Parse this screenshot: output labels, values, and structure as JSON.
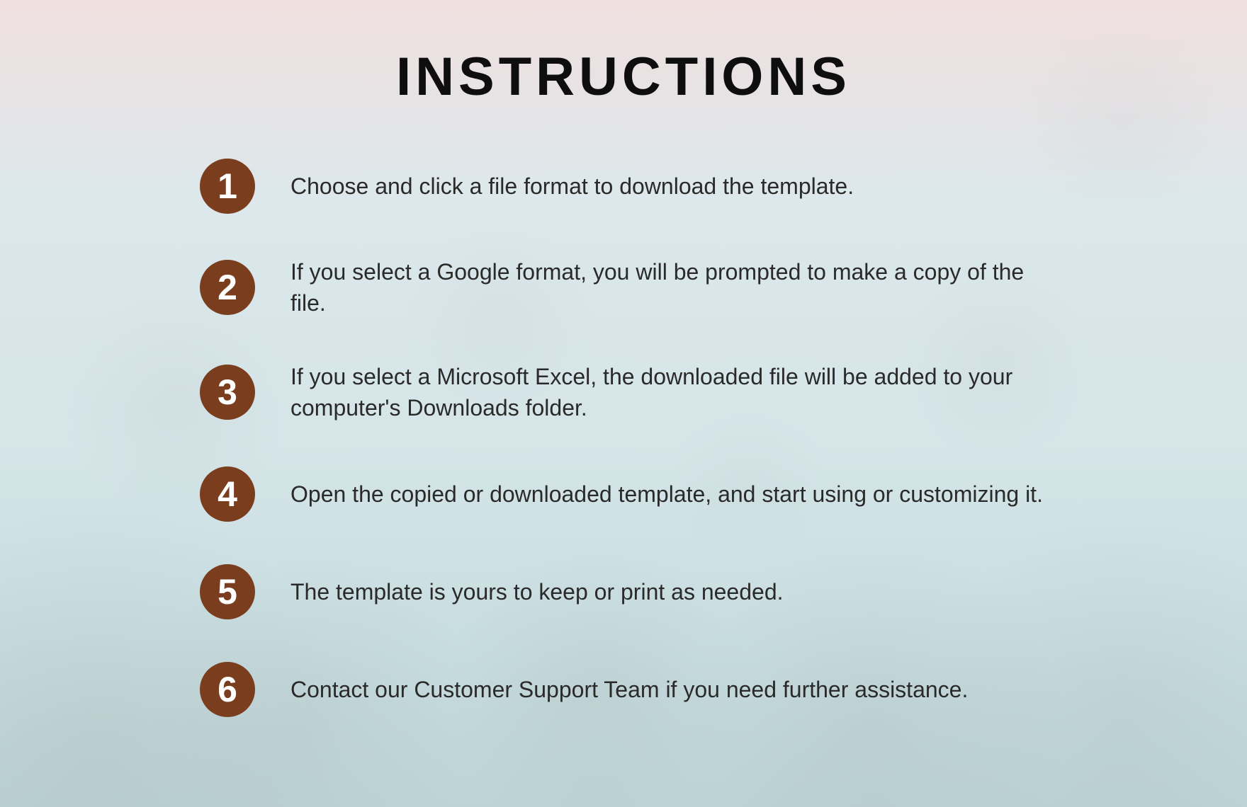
{
  "page": {
    "title": "INSTRUCTIONS"
  },
  "steps": [
    {
      "num": "1",
      "text": "Choose and click a file format to download the template."
    },
    {
      "num": "2",
      "text": "If you select a Google format, you will be prompted to make a copy of the file."
    },
    {
      "num": "3",
      "text": "If you select a Microsoft Excel, the downloaded file will be added to your computer's Downloads folder."
    },
    {
      "num": "4",
      "text": "Open the copied or downloaded template, and start using or customizing it."
    },
    {
      "num": "5",
      "text": "The template is yours to keep or print as needed."
    },
    {
      "num": "6",
      "text": "Contact our Customer Support Team if you need further assistance."
    }
  ],
  "colors": {
    "badge_bg": "#7a3e1f",
    "badge_fg": "#ffffff",
    "title": "#0e0e0e",
    "body_text": "#2a2a2a"
  }
}
